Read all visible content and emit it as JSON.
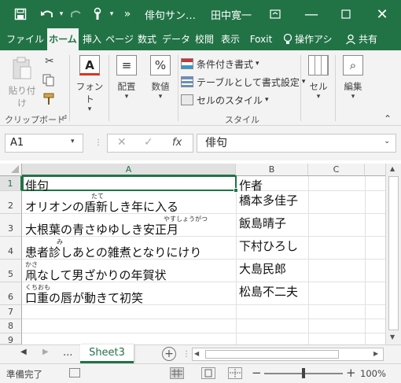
{
  "app": {
    "title": "俳句サン…",
    "user": "田中寛一",
    "accent": "#217346"
  },
  "qat": {
    "save_icon": "save-icon",
    "undo_icon": "undo-icon",
    "redo_icon": "redo-icon",
    "touch_icon": "touch-mode-icon"
  },
  "window_controls": {
    "ribbon_display_icon": "ribbon-display-icon",
    "minimize_icon": "minimize-icon",
    "restore_icon": "restore-icon",
    "close_icon": "close-icon"
  },
  "tabs": [
    {
      "label": "ファイル"
    },
    {
      "label": "ホーム"
    },
    {
      "label": "挿入"
    },
    {
      "label": "ページ"
    },
    {
      "label": "数式"
    },
    {
      "label": "データ"
    },
    {
      "label": "校閲"
    },
    {
      "label": "表示"
    },
    {
      "label": "Foxit"
    }
  ],
  "tell_me": "操作アシ",
  "share": "共有",
  "ribbon": {
    "paste": "貼り付け",
    "clipboard": "クリップボード",
    "font": "フォント",
    "alignment": "配置",
    "number": "数値",
    "conditional": "条件付き書式",
    "table_format": "テーブルとして書式設定",
    "cell_style": "セルのスタイル",
    "style_group": "スタイル",
    "cells": "セル",
    "editing": "編集"
  },
  "formula_bar": {
    "name_box": "A1",
    "fx": "fx",
    "content": "俳句"
  },
  "columns": [
    "A",
    "B",
    "C"
  ],
  "rows": [
    "1",
    "2",
    "3",
    "4",
    "5",
    "6",
    "7",
    "8",
    "9"
  ],
  "cells": {
    "a1": "俳句",
    "b1": "作者",
    "haiku": [
      {
        "text": "オリオンの盾新しき年に入る",
        "author": "橋本多佳子",
        "ruby": "たて"
      },
      {
        "text": "大根葉の青さゆゆしき安正月",
        "author": "飯島晴子",
        "ruby": "やすしょうがつ"
      },
      {
        "text": "患者診しあとの雑煮となりにけり",
        "author": "下村ひろし",
        "ruby": "み"
      },
      {
        "text": "凧なして男ざかりの年賀状",
        "author": "大島民郎",
        "ruby": "かさ"
      },
      {
        "text": "口重の唇が動きて初笑",
        "author": "松島不二夫",
        "ruby": "くちおも"
      }
    ]
  },
  "sheet": {
    "ellipsis": "...",
    "name": "Sheet3"
  },
  "status": {
    "ready": "準備完了",
    "zoom": "100%"
  }
}
